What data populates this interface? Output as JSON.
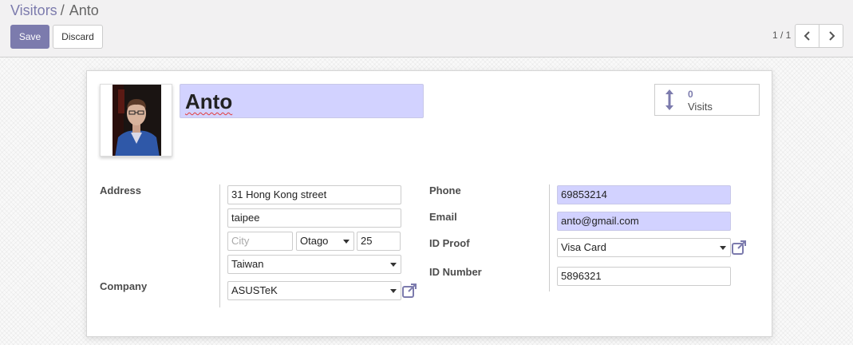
{
  "breadcrumb": {
    "parent": "Visitors",
    "separator": "/",
    "current": "Anto"
  },
  "toolbar": {
    "save_label": "Save",
    "discard_label": "Discard"
  },
  "pager": {
    "value": "1 / 1"
  },
  "icons": {
    "prev": "chevron-left-icon",
    "next": "chevron-right-icon",
    "stat": "arrows-v-icon",
    "external": "external-link-icon"
  },
  "colors": {
    "brand": "#7c7bad",
    "required_field_bg": "#d2d2ff"
  },
  "record": {
    "name": "Anto",
    "stat": {
      "value": "0",
      "label": "Visits"
    }
  },
  "fields": {
    "address_label": "Address",
    "street": "31 Hong Kong street",
    "street2": "taipee",
    "city_placeholder": "City",
    "state": "Otago",
    "zip": "25",
    "country": "Taiwan",
    "company_label": "Company",
    "company": "ASUSTeK",
    "phone_label": "Phone",
    "phone": "69853214",
    "email_label": "Email",
    "email": "anto@gmail.com",
    "id_proof_label": "ID Proof",
    "id_proof": "Visa Card",
    "id_number_label": "ID Number",
    "id_number": "5896321"
  }
}
